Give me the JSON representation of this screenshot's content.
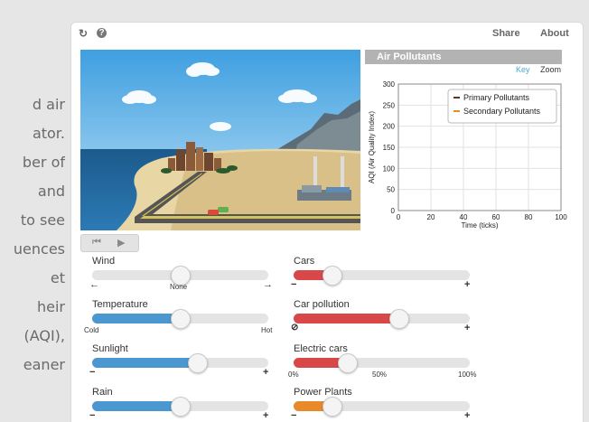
{
  "side_text": {
    "lines": [
      "d air",
      "ator.",
      "ber of",
      " and",
      " to see",
      "uences",
      "et",
      "heir",
      "(AQI),",
      "eaner"
    ]
  },
  "topbar": {
    "reset_icon": "refresh-icon",
    "help_icon": "help-icon",
    "share_label": "Share",
    "about_label": "About"
  },
  "chart": {
    "header": "Air Pollutants",
    "key_label": "Key",
    "zoom_label": "Zoom",
    "accent_color": "#4aa8d8",
    "chart_data": {
      "type": "line",
      "title": "Air Pollutants",
      "xlabel": "Time (ticks)",
      "ylabel": "AQI (Air Quality Index)",
      "xlim": [
        0,
        100
      ],
      "ylim": [
        0,
        300
      ],
      "xticks": [
        "0",
        "20",
        "40",
        "60",
        "80",
        "100"
      ],
      "yticks": [
        "0",
        "50",
        "100",
        "150",
        "200",
        "250",
        "300"
      ],
      "grid": true,
      "legend_position": "top-right",
      "series": [
        {
          "name": "Primary Pollutants",
          "color": "#5a3a1f",
          "values": []
        },
        {
          "name": "Secondary Pollutants",
          "color": "#e8892a",
          "values": []
        }
      ]
    }
  },
  "playback": {
    "step_back_icon": "step-back-icon",
    "play_icon": "play-icon"
  },
  "controls": {
    "wind": {
      "label": "Wind",
      "value": 0.5,
      "min_symbol": "←",
      "center_label": "None",
      "max_symbol": "→",
      "fill_color": "#e4e4e4"
    },
    "temperature": {
      "label": "Temperature",
      "value": 0.5,
      "min_label": "Cold",
      "max_label": "Hot",
      "fill_color": "#4a98cf"
    },
    "sunlight": {
      "label": "Sunlight",
      "value": 0.6,
      "min_symbol": "−",
      "max_symbol": "+",
      "fill_color": "#4a98cf"
    },
    "rain": {
      "label": "Rain",
      "value": 0.5,
      "min_symbol": "−",
      "max_symbol": "+",
      "fill_color": "#4a98cf"
    },
    "cars": {
      "label": "Cars",
      "value": 0.22,
      "min_symbol": "−",
      "max_symbol": "+",
      "fill_color": "#d94848"
    },
    "car_pollution": {
      "label": "Car pollution",
      "value": 0.6,
      "min_symbol": "⊘",
      "max_symbol": "+",
      "fill_color": "#d94848"
    },
    "electric_cars": {
      "label": "Electric cars",
      "value": 0.31,
      "ticks": [
        "0%",
        "50%",
        "100%"
      ],
      "fill_color": "#d94848"
    },
    "power_plants": {
      "label": "Power Plants",
      "value": 0.22,
      "min_symbol": "−",
      "max_symbol": "+",
      "fill_color": "#e8892a"
    }
  }
}
